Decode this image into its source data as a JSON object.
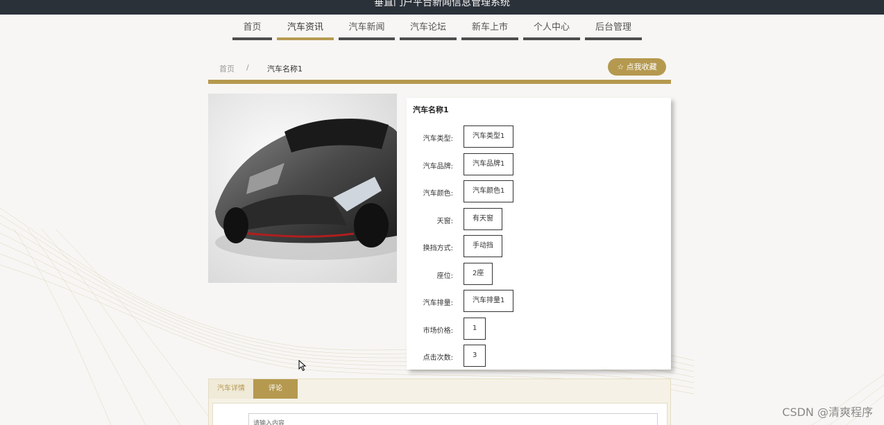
{
  "system_title": "垂直门户平台新闻信息管理系统",
  "nav": [
    {
      "label": "首页",
      "active": false
    },
    {
      "label": "汽车资讯",
      "active": true
    },
    {
      "label": "汽车新闻",
      "active": false
    },
    {
      "label": "汽车论坛",
      "active": false
    },
    {
      "label": "新车上市",
      "active": false
    },
    {
      "label": "个人中心",
      "active": false
    },
    {
      "label": "后台管理",
      "active": false
    }
  ],
  "breadcrumb": {
    "home": "首页",
    "separator": "/",
    "current": "汽车名称1"
  },
  "favorite_button": "☆ 点我收藏",
  "detail": {
    "name": "汽车名称1",
    "fields": [
      {
        "label": "汽车类型:",
        "value": "汽车类型1"
      },
      {
        "label": "汽车品牌:",
        "value": "汽车品牌1"
      },
      {
        "label": "汽车颜色:",
        "value": "汽车颜色1"
      },
      {
        "label": "天窗:",
        "value": "有天窗"
      },
      {
        "label": "换挡方式:",
        "value": "手动挡"
      },
      {
        "label": "座位:",
        "value": "2座"
      },
      {
        "label": "汽车排量:",
        "value": "汽车排量1"
      },
      {
        "label": "市场价格:",
        "value": "1"
      },
      {
        "label": "点击次数:",
        "value": "3"
      }
    ]
  },
  "tabs": {
    "details": "汽车详情",
    "comments": "评论"
  },
  "comment_input": {
    "placeholder": "请输入内容"
  },
  "watermark": "CSDN @清爽程序",
  "colors": {
    "accent": "#b5994f",
    "header_bg": "#2b3139"
  }
}
